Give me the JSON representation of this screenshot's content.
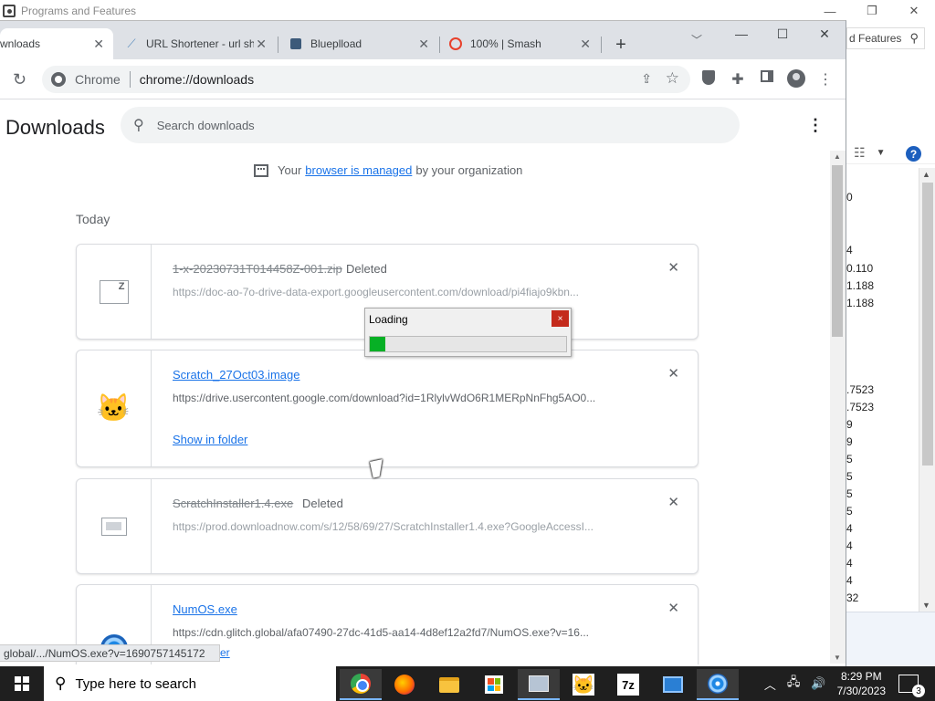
{
  "background_window": {
    "title": "Programs and Features",
    "search_text": "d Features",
    "values": [
      "0",
      "4",
      "0.110",
      "1.188",
      "1.188",
      ".7523",
      ".7523",
      "9",
      "9",
      "5",
      "5",
      "5",
      "5",
      "4",
      "4",
      "4",
      "4",
      "32"
    ]
  },
  "tabs": [
    {
      "label": "wnloads",
      "active": true
    },
    {
      "label": "URL Shortener - url sh",
      "active": false
    },
    {
      "label": "Blueplload",
      "active": false
    },
    {
      "label": "100% | Smash",
      "active": false
    }
  ],
  "omnibox": {
    "chip": "Chrome",
    "url": "chrome://downloads"
  },
  "downloads": {
    "title": "Downloads",
    "search_placeholder": "Search downloads",
    "managed_prefix": "Your",
    "managed_link": "browser is managed",
    "managed_suffix": "by your organization",
    "date_label": "Today",
    "items": [
      {
        "name": "1-x-20230731T014458Z-001.zip",
        "status": "Deleted",
        "url": "https://doc-ao-7o-drive-data-export.googleusercontent.com/download/pi4fiajo9kbn...",
        "action": "",
        "icon": "zip-file-icon"
      },
      {
        "name": "Scratch_27Oct03.image",
        "status": "",
        "url": "https://drive.usercontent.google.com/download?id=1RlylvWdO6R1MERpNnFhg5AO0...",
        "action": "Show in folder",
        "icon": "scratch-cat-icon"
      },
      {
        "name": "ScratchInstaller1.4.exe",
        "status": "Deleted",
        "url": "https://prod.downloadnow.com/s/12/58/69/27/ScratchInstaller1.4.exe?GoogleAccessI...",
        "action": "",
        "icon": "exe-file-icon"
      },
      {
        "name": "NumOS.exe",
        "status": "",
        "url": "https://cdn.glitch.global/afa07490-27dc-41d5-aa14-4d8ef12a2fd7/NumOS.exe?v=16...",
        "action": "",
        "icon": "disc-icon"
      }
    ]
  },
  "status_bar": {
    "url": "global/.../NumOS.exe?v=1690757145172",
    "tail": "er"
  },
  "loading_dialog": {
    "title": "Loading",
    "close": "×",
    "progress": 0.08,
    "fill_color": "#06b025"
  },
  "taskbar": {
    "search_placeholder": "Type here to search",
    "time": "8:29 PM",
    "date": "7/30/2023",
    "notification_count": "3",
    "zip_label": "7z"
  }
}
